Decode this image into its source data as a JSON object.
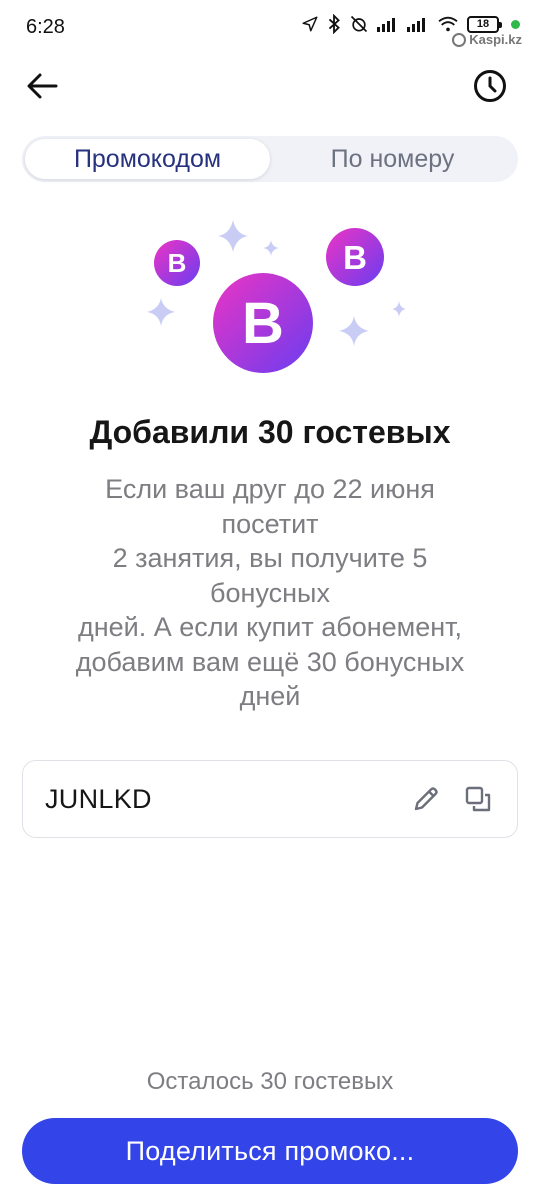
{
  "status_bar": {
    "time": "6:28",
    "battery": "18",
    "watermark": "Kaspi.kz"
  },
  "tabs": [
    {
      "label": "Промокодом",
      "active": true
    },
    {
      "label": "По номеру",
      "active": false
    }
  ],
  "illustration": {
    "badge_letter": "B",
    "colors": {
      "gradient_start": "#ec34c4",
      "gradient_end": "#6a3df0",
      "sparkle": "#c9cdf6"
    }
  },
  "content": {
    "title": "Добавили 30 гостевых",
    "description_lines": [
      "Если ваш друг до 22 июня",
      "посетит",
      "2 занятия, вы получите 5",
      "бонусных",
      "дней. А если купит абонемент,",
      "добавим вам ещё 30 бонусных",
      "дней"
    ]
  },
  "promo": {
    "code": "JUNLKD",
    "edit_icon": "pencil-icon",
    "copy_icon": "copy-icon"
  },
  "footer": {
    "remaining": "Осталось 30 гостевых",
    "share_label": "Поделиться промоко..."
  },
  "colors": {
    "accent": "#3344e8",
    "active_tab_text": "#27327f",
    "muted_text": "#7d7d82"
  }
}
